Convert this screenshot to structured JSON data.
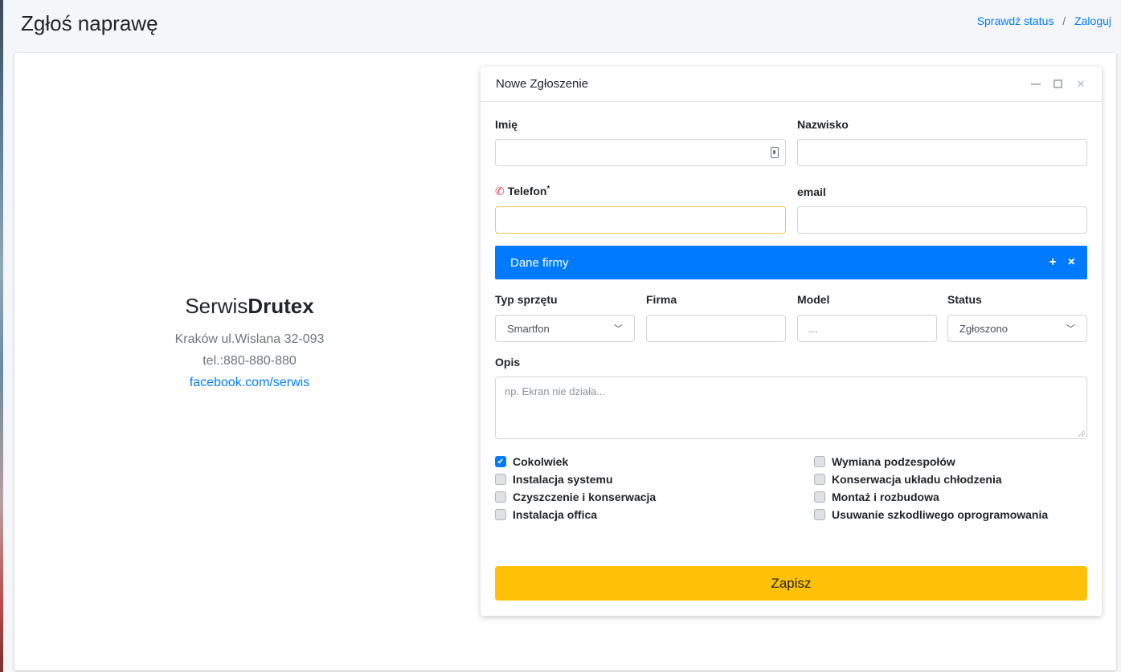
{
  "header": {
    "title": "Zgłoś naprawę",
    "breadcrumb": {
      "check_status": "Sprawdź status",
      "separator": "/",
      "login": "Zaloguj"
    }
  },
  "company": {
    "name_light": "Serwis",
    "name_bold": "Drutex",
    "address": "Kraków ul.Wislana 32-093",
    "phone": "tel.:880-880-880",
    "facebook": "facebook.com/serwis"
  },
  "form": {
    "title": "Nowe Zgłoszenie",
    "icons": {
      "minimize": "minus-icon",
      "maximize": "expand-icon",
      "close": "close-icon"
    },
    "fields": {
      "first_name_label": "Imię",
      "last_name_label": "Nazwisko",
      "phone_label": "Telefon",
      "phone_required": "*",
      "email_label": "email"
    },
    "section": {
      "title": "Dane firmy",
      "add": "+",
      "close": "×"
    },
    "device": {
      "type_label": "Typ sprzętu",
      "type_value": "Smartfon",
      "company_label": "Firma",
      "model_label": "Model",
      "model_placeholder": "...",
      "status_label": "Status",
      "status_value": "Zgłoszono"
    },
    "description": {
      "label": "Opis",
      "placeholder": "np. Ekran nie działa..."
    },
    "checks_left": [
      {
        "label": "Cokolwiek",
        "checked": true
      },
      {
        "label": "Instalacja systemu",
        "checked": false
      },
      {
        "label": "Czyszczenie i konserwacja",
        "checked": false
      },
      {
        "label": "Instalacja offica",
        "checked": false
      }
    ],
    "checks_right": [
      {
        "label": "Wymiana podzespołów",
        "checked": false
      },
      {
        "label": "Konserwacja układu chłodzenia",
        "checked": false
      },
      {
        "label": "Montaż i rozbudowa",
        "checked": false
      },
      {
        "label": "Usuwanie szkodliwego oprogramowania",
        "checked": false
      }
    ],
    "save_label": "Zapisz"
  },
  "colors": {
    "accent": "#007bff",
    "save": "#ffc107",
    "phone_icon": "#dc3545"
  }
}
